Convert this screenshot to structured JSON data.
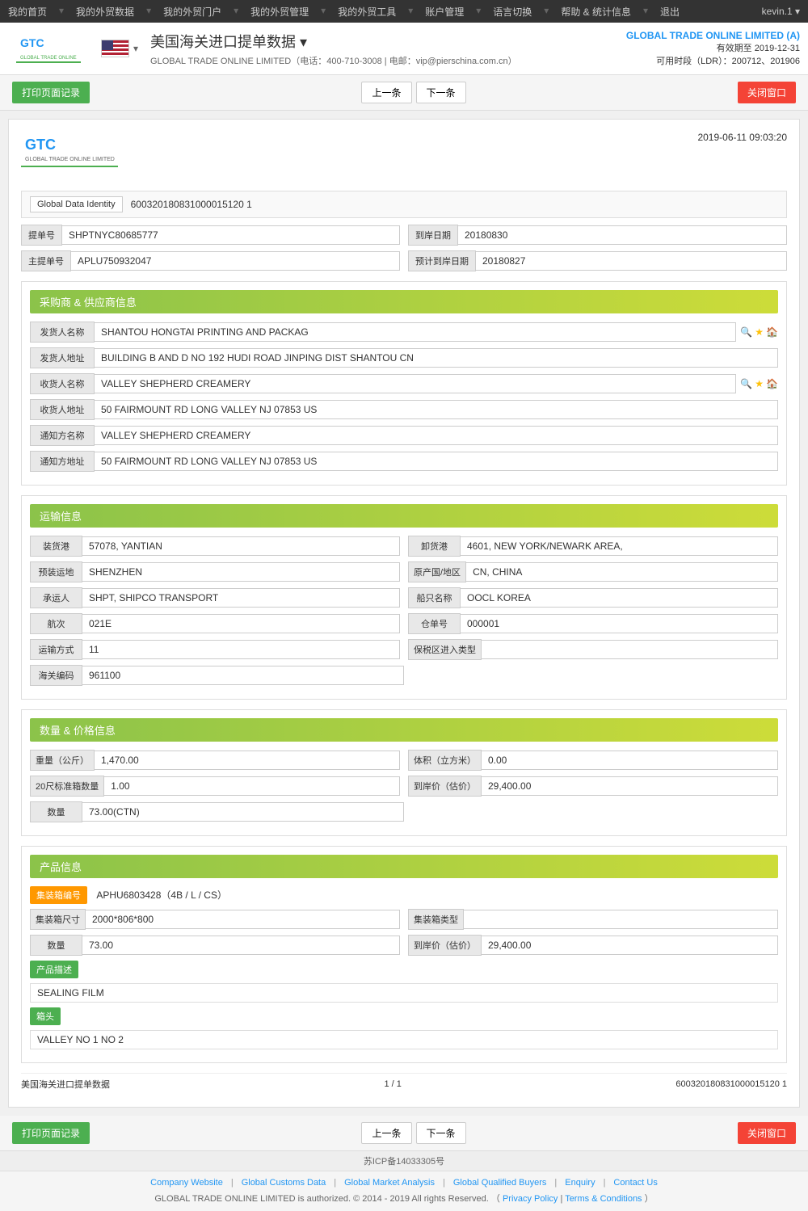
{
  "topnav": {
    "items": [
      {
        "label": "我的首页",
        "id": "home"
      },
      {
        "label": "我的外贸数据",
        "id": "trade-data"
      },
      {
        "label": "我的外贸门户",
        "id": "portal"
      },
      {
        "label": "我的外贸管理",
        "id": "management"
      },
      {
        "label": "我的外贸工具",
        "id": "tools"
      },
      {
        "label": "账户管理",
        "id": "account"
      },
      {
        "label": "语言切换",
        "id": "language"
      },
      {
        "label": "帮助 & 统计信息",
        "id": "help"
      },
      {
        "label": "退出",
        "id": "logout"
      }
    ],
    "user": "kevin.1 ▾"
  },
  "header": {
    "title": "美国海关进口提单数据 ▾",
    "subtitle": "GLOBAL TRADE ONLINE LIMITED（电话：400-710-3008 | 电邮：vip@pierschina.com.cn）",
    "company": "GLOBAL TRADE ONLINE LIMITED (A)",
    "validity": "有效期至 2019-12-31",
    "ldr": "可用时段（LDR）：200712、201906"
  },
  "toolbar": {
    "print": "打印页面记录",
    "prev": "上一条",
    "next": "下一条",
    "close": "关闭窗口"
  },
  "doc": {
    "timestamp": "2019-06-11 09:03:20",
    "gdi_label": "Global Data Identity",
    "gdi_value": "600320180831000015120 1",
    "bill_label": "提单号",
    "bill_value": "SHPTNYC80685777",
    "arrival_label": "到岸日期",
    "arrival_value": "20180830",
    "master_bill_label": "主提单号",
    "master_bill_value": "APLU750932047",
    "est_arrival_label": "预计到岸日期",
    "est_arrival_value": "20180827"
  },
  "buyer_supplier": {
    "section_title": "采购商 & 供应商信息",
    "shipper_name_label": "发货人名称",
    "shipper_name_value": "SHANTOU HONGTAI PRINTING AND PACKAG",
    "shipper_addr_label": "发货人地址",
    "shipper_addr_value": "BUILDING B AND D NO 192 HUDI ROAD JINPING DIST SHANTOU CN",
    "consignee_name_label": "收货人名称",
    "consignee_name_value": "VALLEY SHEPHERD CREAMERY",
    "consignee_addr_label": "收货人地址",
    "consignee_addr_value": "50 FAIRMOUNT RD LONG VALLEY NJ 07853 US",
    "notify_name_label": "通知方名称",
    "notify_name_value": "VALLEY SHEPHERD CREAMERY",
    "notify_addr_label": "通知方地址",
    "notify_addr_value": "50 FAIRMOUNT RD LONG VALLEY NJ 07853 US"
  },
  "transport": {
    "section_title": "运输信息",
    "loading_port_label": "装货港",
    "loading_port_value": "57078, YANTIAN",
    "unloading_port_label": "卸货港",
    "unloading_port_value": "4601, NEW YORK/NEWARK AREA,",
    "pre_dest_label": "预装运地",
    "pre_dest_value": "SHENZHEN",
    "origin_label": "原产国/地区",
    "origin_value": "CN, CHINA",
    "carrier_label": "承运人",
    "carrier_value": "SHPT, SHIPCO TRANSPORT",
    "vessel_label": "船只名称",
    "vessel_value": "OOCL KOREA",
    "voyage_label": "航次",
    "voyage_value": "021E",
    "warehouse_label": "仓单号",
    "warehouse_value": "000001",
    "transport_mode_label": "运输方式",
    "transport_mode_value": "11",
    "bonded_label": "保税区进入类型",
    "bonded_value": "",
    "customs_code_label": "海关编码",
    "customs_code_value": "961100"
  },
  "quantity_price": {
    "section_title": "数量 & 价格信息",
    "weight_label": "重量（公斤）",
    "weight_value": "1,470.00",
    "volume_label": "体积（立方米）",
    "volume_value": "0.00",
    "container20_label": "20尺标准箱数量",
    "container20_value": "1.00",
    "shore_price_label": "到岸价（估价）",
    "shore_price_value": "29,400.00",
    "quantity_label": "数量",
    "quantity_value": "73.00(CTN)"
  },
  "product": {
    "section_title": "产品信息",
    "container_no_label": "集装箱编号",
    "container_no_value": "APHU6803428（4B / L / CS）",
    "container_size_label": "集装箱尺寸",
    "container_size_value": "2000*806*800",
    "container_type_label": "集装箱类型",
    "container_type_value": "",
    "quantity_label": "数量",
    "quantity_value": "73.00",
    "shore_price_label": "到岸价（估价）",
    "shore_price_value": "29,400.00",
    "desc_label": "产品描述",
    "desc_value": "SEALING FILM",
    "mark_label": "箱头",
    "mark_value": "VALLEY NO 1 NO 2"
  },
  "page_footer": {
    "doc_title": "美国海关进口提单数据",
    "page_info": "1 / 1",
    "gdi": "600320180831000015120 1"
  },
  "footer": {
    "links": [
      {
        "label": "Company Website"
      },
      {
        "label": "Global Customs Data"
      },
      {
        "label": "Global Market Analysis"
      },
      {
        "label": "Global Qualified Buyers"
      },
      {
        "label": "Enquiry"
      },
      {
        "label": "Contact Us"
      }
    ],
    "copyright": "GLOBAL TRADE ONLINE LIMITED is authorized. © 2014 - 2019 All rights Reserved.",
    "privacy": "Privacy Policy",
    "terms": "Terms & Conditions",
    "icp": "苏ICP备14033305号"
  }
}
